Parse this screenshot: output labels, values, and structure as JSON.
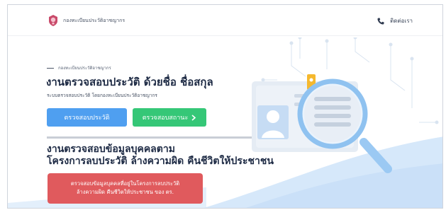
{
  "header": {
    "brand": "กองทะเบียนประวัติอาชญากร",
    "contact_label": "ติดต่อเรา",
    "icons": {
      "logo": "police-seal-icon",
      "contact": "phone-icon"
    }
  },
  "hero": {
    "kicker": "กองทะเบียนประวัติอาชญากร",
    "title": "งานตรวจสอบประวัติ ด้วยชื่อ ชื่อสกุล",
    "subtitle": "ระบบตรวจสอบประวัติ โดยกองทะเบียนประวัติอาชญากร",
    "btn_check_history": "ตรวจสอบประวัติ",
    "btn_check_status": "ตรวจสอบสถานะ",
    "btn_check_status_icon": "chevron-right-icon"
  },
  "section2": {
    "heading_line1": "งานตรวจสอบข้อมูลบุคคลตาม",
    "heading_line2": "โครงการลบประวัติ ล้างความผิด คืนชีวิตให้ประชาชน",
    "btn_line1": "ตรวจสอบข้อมูลบุคคลที่อยู่ในโครงการลบประวัติ",
    "btn_line2": "ล้างความผิด คืนชีวิตให้ประชาชน ของ ตร."
  },
  "colors": {
    "blue": "#4f9ff0",
    "green": "#35c777",
    "red": "#e05a5d",
    "wave": "#dcecfb",
    "heading": "#1d2a44"
  }
}
